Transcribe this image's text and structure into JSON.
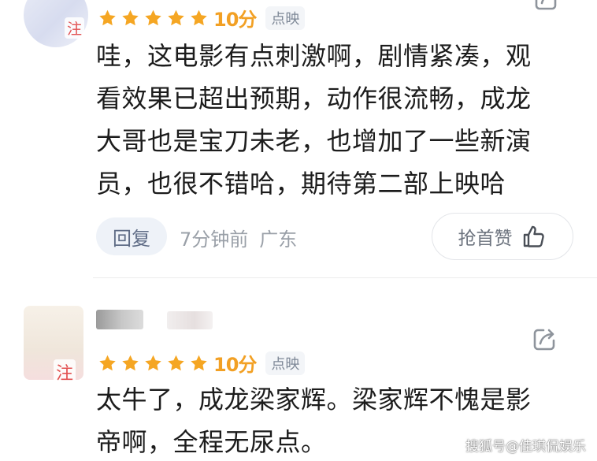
{
  "comments": [
    {
      "follow_badge": "注",
      "rating": {
        "stars": 5,
        "score_text": "10分",
        "source": "点映"
      },
      "text_lines": [
        "哇，这电影有点刺激啊，剧情紧凑，观",
        "看效果已超出预期，动作很流畅，成龙",
        "大哥也是宝刀未老，也增加了一些新演",
        "员，也很不错哈，期待第二部上映哈"
      ],
      "reply_label": "回复",
      "time": "7分钟前",
      "location": "广东",
      "like_label": "抢首赞"
    },
    {
      "follow_badge": "注",
      "rating": {
        "stars": 5,
        "score_text": "10分",
        "source": "点映"
      },
      "text_lines": [
        "太牛了，成龙梁家辉。梁家辉不愧是影",
        "帝啊，全程无尿点。"
      ]
    }
  ],
  "watermark": "搜狐号@佳琪侃娱乐",
  "colors": {
    "star": "#f5a623",
    "score": "#f2a024",
    "follow": "#e25151",
    "reply_bg": "#eef2f8",
    "reply_text": "#5f6c86",
    "meta_text": "#9aa0a8"
  },
  "icons": [
    "star-icon",
    "share-icon",
    "thumbs-up-icon"
  ]
}
